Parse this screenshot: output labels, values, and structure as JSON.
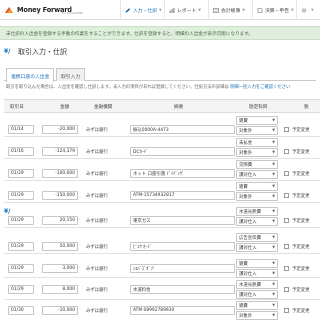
{
  "app": {
    "logo_text": "Money Forward",
    "logo_sub": "for MAGAZINE"
  },
  "nav": [
    {
      "label": "入力・仕訳",
      "icon": "pencil-icon",
      "active": true
    },
    {
      "label": "レポート",
      "icon": "chart-icon",
      "active": false
    },
    {
      "label": "会計帳簿",
      "icon": "ledger-icon",
      "active": false
    },
    {
      "label": "決算・申告",
      "icon": "document-icon",
      "active": false
    },
    {
      "label": "",
      "icon": "settings-icon",
      "active": false
    }
  ],
  "banner": "未仕訳の入出金を登録する手動の作業をすることができます。仕訳を登録すると、明細の入出金が表示可能になります。",
  "section1": {
    "title": "取引入力・仕訳",
    "tabs": [
      "連携口座の入出金",
      "取引入力"
    ],
    "desc_prefix": "取引を取り込んだ場合は、入出金を確認し仕訳します。未入力の項目があれば登録してください。仕訳方法の詳細は ",
    "desc_link": "明細一括入力をご確認ください"
  },
  "table": {
    "headers": [
      "取引日",
      "金額",
      "金融機関",
      "摘要",
      "勘定科目",
      "税"
    ],
    "rows": [
      {
        "date": "01/14",
        "amount": "-20,000",
        "bank": "みずほ銀行",
        "memo": "振込0000A-4473",
        "account": "雑費",
        "tax": "対象外",
        "check_label": "予定変更"
      },
      {
        "date": "01/16",
        "amount": "-124,379",
        "bank": "みずほ銀行",
        "memo": "DCｶｰﾄﾞ",
        "account": "未払金",
        "tax": "対象外",
        "check_label": "予定変更"
      },
      {
        "date": "01/29",
        "amount": "-100,000",
        "bank": "みずほ銀行",
        "memo": "ネット 口座引落 ﾄﾞｲﾂﾞﾝｳﾞ",
        "account": "交際費",
        "tax": "課対仕入",
        "check_label": "予定変更"
      },
      {
        "date": "01/29",
        "amount": "-150,000",
        "bank": "みずほ銀行",
        "memo": "ATM-15734932817",
        "account": "雑費",
        "tax": "対象外",
        "check_label": "予定変更"
      }
    ]
  },
  "section2": {
    "rows": [
      {
        "date": "01/29",
        "amount": "20,150",
        "bank": "みずほ銀行",
        "memo": "東京ガス",
        "account": "水道光熱費",
        "tax": "課対仕入",
        "check_label": "予定変更"
      },
      {
        "date": "01/29",
        "amount": "50,000",
        "bank": "みずほ銀行",
        "memo": "ﾋﾞﾕｳ ｶｰﾄﾞ",
        "account": "広告宣伝費",
        "tax": "課対仕入",
        "check_label": "予定変更"
      },
      {
        "date": "01/29",
        "amount": "3,000",
        "bank": "みずほ銀行",
        "memo": "ｼｴﾊﾞｽﾞﾀﾞﾌﾟ",
        "account": "雑費",
        "tax": "課対仕入",
        "check_label": "予定変更"
      },
      {
        "date": "01/29",
        "amount": "8,000",
        "bank": "みずほ銀行",
        "memo": "水道料金",
        "account": "水道光熱費",
        "tax": "課対仕入",
        "check_label": "予定変更"
      },
      {
        "date": "01/30",
        "amount": "-10,000",
        "bank": "みずほ銀行",
        "memo": "ATM 08992789930",
        "account": "雑費",
        "tax": "対象外",
        "check_label": "予定変更"
      }
    ]
  },
  "colors": {
    "accent": "#1a6fb6",
    "banner_bg": "#dfeedd"
  }
}
